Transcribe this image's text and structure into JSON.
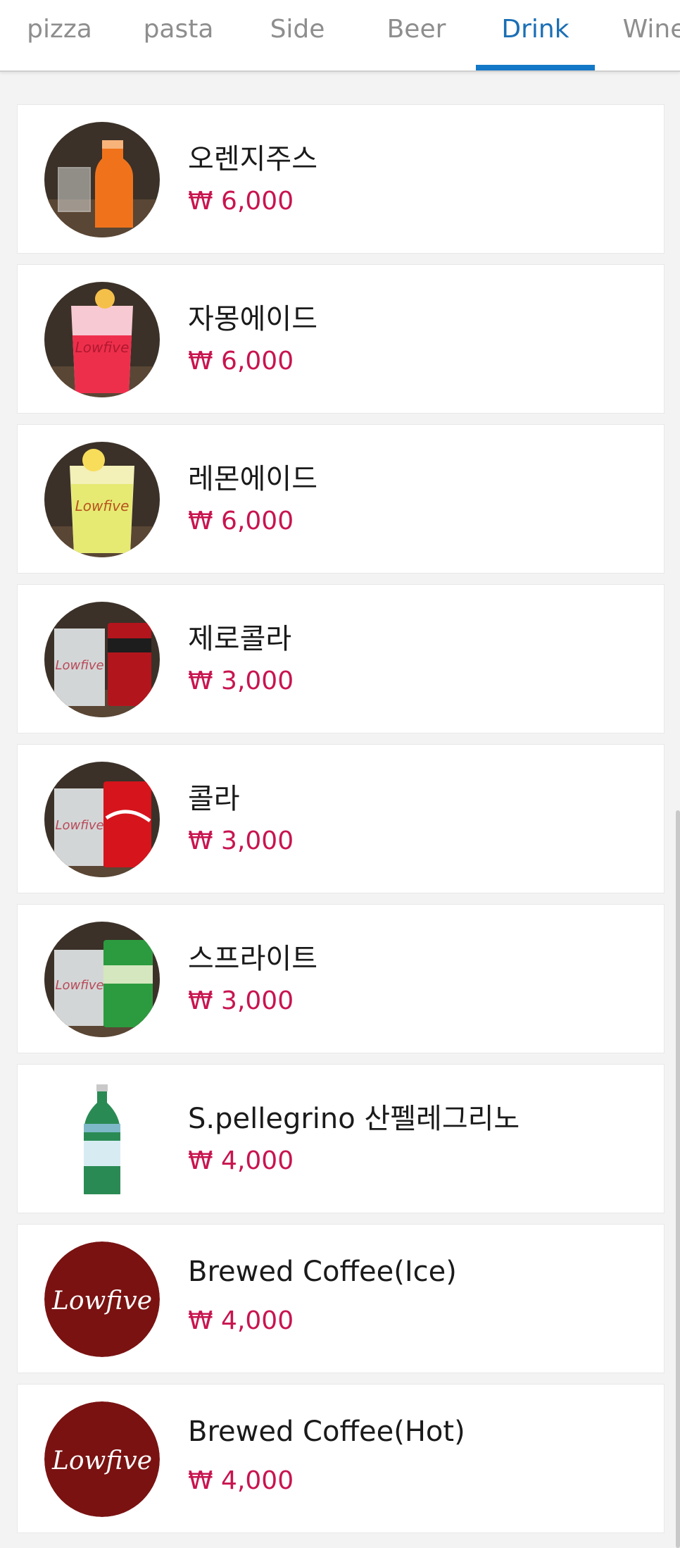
{
  "tabs": [
    {
      "label": "pizza",
      "active": false
    },
    {
      "label": "pasta",
      "active": false
    },
    {
      "label": "Side",
      "active": false
    },
    {
      "label": "Beer",
      "active": false
    },
    {
      "label": "Drink",
      "active": true
    },
    {
      "label": "Wine",
      "active": false
    }
  ],
  "colors": {
    "accent": "#1478c8",
    "price": "#c8144f",
    "brand_circle": "#7a1212"
  },
  "menu": {
    "items": [
      {
        "name": "오렌지주스",
        "price": "₩ 6,000",
        "image": "orange-juice-photo"
      },
      {
        "name": "자몽에이드",
        "price": "₩ 6,000",
        "image": "grapefruit-ade-photo"
      },
      {
        "name": "레몬에이드",
        "price": "₩ 6,000",
        "image": "lemonade-photo"
      },
      {
        "name": "제로콜라",
        "price": "₩ 3,000",
        "image": "zero-cola-photo"
      },
      {
        "name": "콜라",
        "price": "₩ 3,000",
        "image": "cola-photo"
      },
      {
        "name": "스프라이트",
        "price": "₩ 3,000",
        "image": "sprite-photo"
      },
      {
        "name": "S.pellegrino 산펠레그리노",
        "price": "₩ 4,000",
        "image": "pellegrino-bottle-photo"
      },
      {
        "name": "Brewed Coffee(Ice)",
        "price": "₩ 4,000",
        "image": "lowfive-logo",
        "logo_text": "Lowfive"
      },
      {
        "name": "Brewed Coffee(Hot)",
        "price": "₩ 4,000",
        "image": "lowfive-logo",
        "logo_text": "Lowfive"
      }
    ]
  }
}
